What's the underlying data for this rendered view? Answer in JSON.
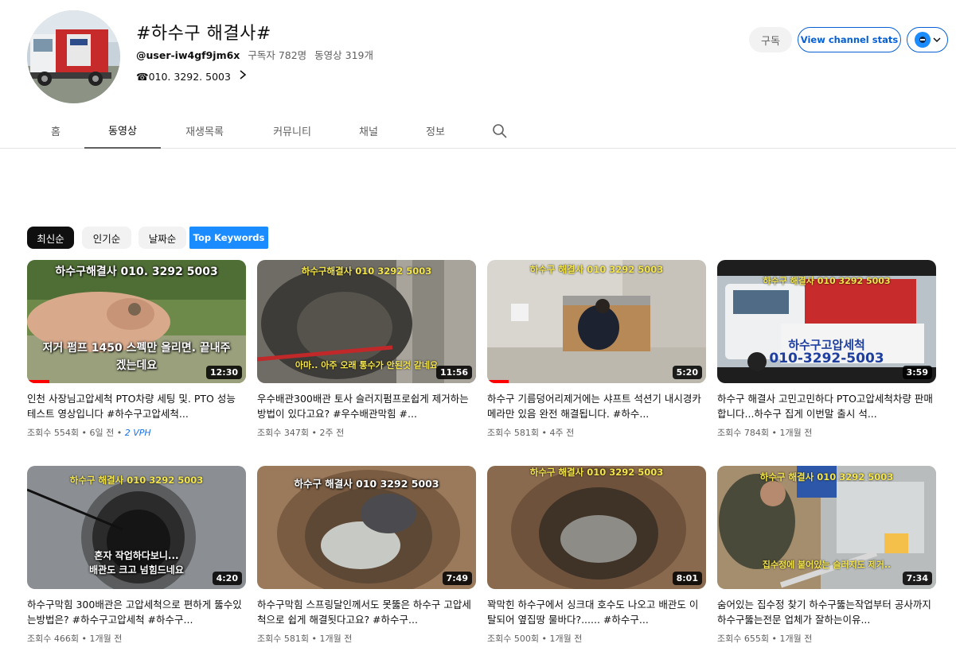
{
  "channel": {
    "title": "#하수구 해결사#",
    "handle": "@user-iw4gf9jm6x",
    "subscribers": "구독자 782명",
    "videos": "동영상 319개",
    "link": "☎010. 3292. 5003"
  },
  "actions": {
    "subscribe_label": "구독",
    "stats_label": "View channel stats"
  },
  "tabs": [
    {
      "label": "홈"
    },
    {
      "label": "동영상"
    },
    {
      "label": "재생목록"
    },
    {
      "label": "커뮤니티"
    },
    {
      "label": "채널"
    },
    {
      "label": "정보"
    }
  ],
  "sort_chips": [
    {
      "label": "최신순"
    },
    {
      "label": "인기순"
    },
    {
      "label": "날짜순"
    },
    {
      "label": "Top Keywords"
    }
  ],
  "videos": [
    {
      "overlay_top": "하수구해결사 010. 3292 5003",
      "overlay_bottom_1": "저거 펌프 1450 스펙만 올리면. 끝내주",
      "overlay_bottom_2": "겠는데요",
      "duration": "12:30",
      "progress": 0.1,
      "title": "인천 사장님고압세척 PTO차량 세팅 및. PTO 성능 테스트 영상입니다 #하수구고압세척...",
      "views": "조회수 554회",
      "age": "6일 전",
      "vph": "2 VPH"
    },
    {
      "overlay_top": "하수구해결사 010 3292 5003",
      "overlay_bottom_1": "아마.. 아주 오래 통수가 안된것 같네요",
      "duration": "11:56",
      "title": "우수배관300배관 토사 슬러지펌프로쉽게 제거하는방법이 있다고요? #우수배관막힘 #...",
      "views": "조회수 347회",
      "age": "2주 전"
    },
    {
      "overlay_top": "하수구 해결사 010 3292 5003",
      "duration": "5:20",
      "progress": 0.1,
      "title": "하수구 기름덩어리제거에는 샤프트 석션기 내시경카메라만 있음 완전 해결됩니다. #하수...",
      "views": "조회수 581회",
      "age": "4주 전"
    },
    {
      "overlay_top": "하수구 해결사 010 3292 5003",
      "overlay_bottom_1": "하수구고압세척",
      "overlay_bottom_2": "010-3292-5003",
      "duration": "3:59",
      "title": "하수구 해결사 고민고민하다 PTO고압세척차량 판매합니다...하수구 집게 이번말 출시 석...",
      "views": "조회수 784회",
      "age": "1개월 전"
    },
    {
      "overlay_top": "하수구 해결사 010 3292 5003",
      "overlay_bottom_1": "혼자 작업하다보니...",
      "overlay_bottom_2": "배관도 크고 넘힘드네요",
      "duration": "4:20",
      "title": "하수구막힘 300배관은 고압세척으로 편하게 뚫수있는방법은? #하수구고압세척 #하수구...",
      "views": "조회수 466회",
      "age": "1개월 전"
    },
    {
      "overlay_top": "하수구 해결사 010 3292 5003",
      "duration": "7:49",
      "title": "하수구막힘 스프링달인께서도 못뚫은 하수구 고압세척으로 쉽게 해결됫다고요? #하수구...",
      "views": "조회수 581회",
      "age": "1개월 전"
    },
    {
      "overlay_top": "하수구 해결사 010 3292 5003",
      "duration": "8:01",
      "title": "꽉막힌 하수구에서 싱크대 호수도 나오고 배관도 이탈되어 옆집땅 물바다?...... #하수구...",
      "views": "조회수 500회",
      "age": "1개월 전"
    },
    {
      "overlay_top": "하수구 해결사 010 3292 5003",
      "overlay_bottom_1": "집수정에 붙어있는 슬러지도 제거..",
      "duration": "7:34",
      "title": "숨어있는 집수정 찾기 하수구뚫는작업부터 공사까지 하수구뚫는전문 업체가 잘하는이유...",
      "views": "조회수 655회",
      "age": "1개월 전"
    }
  ]
}
